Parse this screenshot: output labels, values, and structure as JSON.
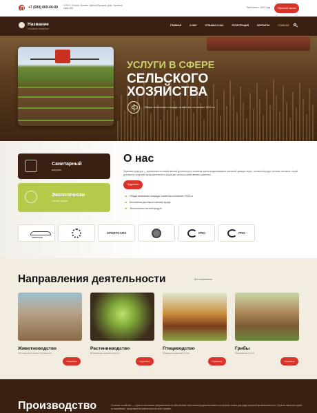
{
  "topbar": {
    "phone": "+7 (000) 000-00-00",
    "address": "127017, Россия, Москва, Цветной бульвар, дом, строение, офис 406",
    "hours": "Работаем с 2007 года",
    "callback_label": "Обратный звонок"
  },
  "header": {
    "logo_title": "Название",
    "logo_subtitle": "Сельское хозяйство",
    "menu": [
      {
        "label": "ГЛАВНАЯ"
      },
      {
        "label": "О НАС"
      },
      {
        "label": "ОТЗЫВЫ О НАС"
      },
      {
        "label": "РЕГИСТРАЦИЯ"
      },
      {
        "label": "КОНТАКТЫ"
      },
      {
        "label": "ГЛАВНАЯ"
      }
    ]
  },
  "hero": {
    "title_line1": "УСЛУГИ В СФЕРЕ",
    "title_line2": "СЕЛЬСКОГО",
    "title_line3": "ХОЗЯЙСТВА",
    "note": "Общая земельная площадь хозяйства составляет 9034 га"
  },
  "about": {
    "title": "О нас",
    "text": "Зерновые культуры — приемлемость хозяйственной деятельности человека группа возделываемых растений, дающих зерно, основной продукт питания человека, сырьё для многих отраслей промышленности и корма для сельскохозяйственных животных.",
    "more_label": "Подробнее",
    "bullets": [
      "Общая земельная площадь хозяйства составляет 9034 га",
      "Бесплатная доставка в вашем городе",
      "Экологически чистый продукт"
    ],
    "cards": [
      {
        "title": "Санитарный",
        "subtitle": "контроль"
      },
      {
        "title": "Экологически",
        "subtitle": "чистый продукт"
      }
    ],
    "brands": [
      "SPEEDSTAR",
      "",
      "SPORTCARS",
      "",
      "PRO",
      "PRO"
    ]
  },
  "directions": {
    "title": "Направления деятельности",
    "all_link": "Все направления",
    "items": [
      {
        "name": "Животноводство",
        "subtitle": "Скотоводство и мясное производство",
        "button": "Подробнее"
      },
      {
        "name": "Растениеводство",
        "subtitle": "Выращивание зерновых культур",
        "button": "Подробнее"
      },
      {
        "name": "Птицеводство",
        "subtitle": "Разведение домашней птицы",
        "button": "Подробнее"
      },
      {
        "name": "Грибы",
        "subtitle": "Выращивание грибов",
        "button": "Подробнее"
      }
    ]
  },
  "production": {
    "title": "Производство",
    "text": "Сельское хозяйство — отрасль экономики, направленная на обеспечение населения продовольствием и получение сырья для ряда отраслей промышленности. Отрасль является одной из важнейших, представлена практически во всех странах."
  },
  "colors": {
    "brand_dark": "#3a1f13",
    "accent_red": "#d9332a",
    "accent_green": "#b5c94b",
    "gold": "#c9a26a"
  }
}
